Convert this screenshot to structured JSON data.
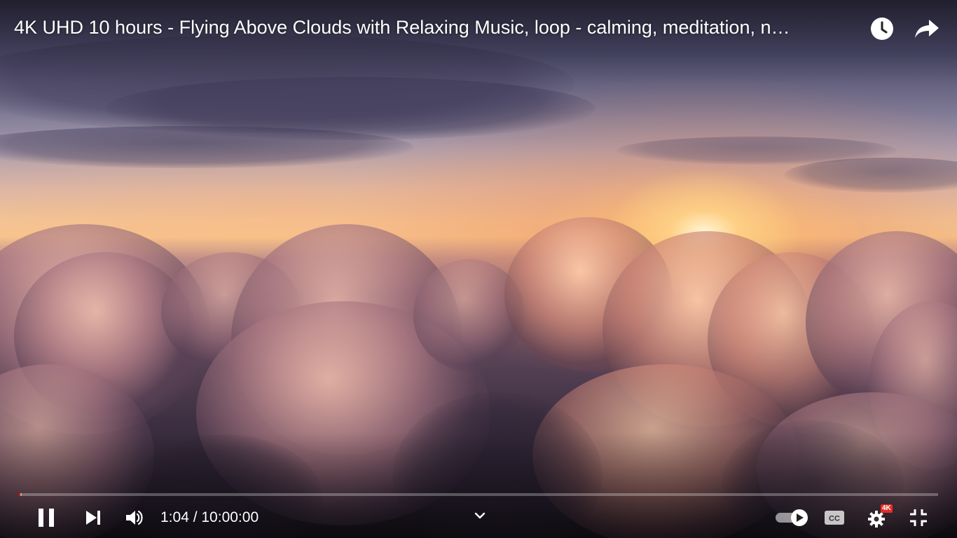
{
  "video": {
    "title": "4K UHD 10 hours - Flying Above Clouds with Relaxing Music, loop - calming, meditation, n…",
    "progress_fraction": 0.0018
  },
  "controls": {
    "time_display": "1:04 / 10:00:00",
    "quality_badge": "4K"
  },
  "colors": {
    "progress_played": "#ff0000",
    "badge_bg": "#e52d27"
  },
  "icons": {
    "watch_later": "clock-icon",
    "share": "share-arrow-icon",
    "pause": "pause-icon",
    "next": "next-icon",
    "volume": "volume-icon",
    "expand": "chevron-down-icon",
    "autoplay": "autoplay-toggle-icon",
    "captions": "cc-icon",
    "settings": "gear-icon",
    "fullscreen_exit": "exit-fullscreen-icon"
  }
}
